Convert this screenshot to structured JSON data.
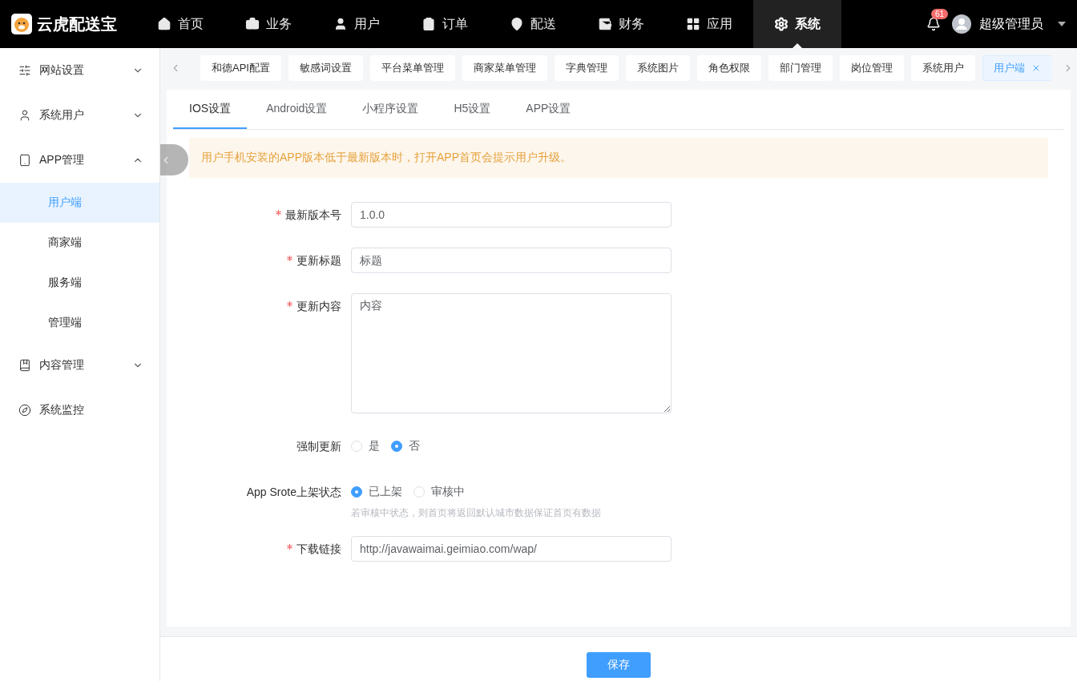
{
  "logo": {
    "text": "云虎配送宝"
  },
  "nav": [
    {
      "label": "首页",
      "selected": false
    },
    {
      "label": "业务",
      "selected": false
    },
    {
      "label": "用户",
      "selected": false
    },
    {
      "label": "订单",
      "selected": false
    },
    {
      "label": "配送",
      "selected": false
    },
    {
      "label": "财务",
      "selected": false
    },
    {
      "label": "应用",
      "selected": false
    },
    {
      "label": "系统",
      "selected": true
    }
  ],
  "notifications": {
    "count": "61"
  },
  "user": {
    "name": "超级管理员"
  },
  "sidebar": {
    "items": [
      {
        "label": "网站设置",
        "expanded": false
      },
      {
        "label": "系统用户",
        "expanded": false
      },
      {
        "label": "APP管理",
        "expanded": true,
        "children": [
          {
            "label": "用户端",
            "selected": true
          },
          {
            "label": "商家端",
            "selected": false
          },
          {
            "label": "服务端",
            "selected": false
          },
          {
            "label": "管理端",
            "selected": false
          }
        ]
      },
      {
        "label": "内容管理",
        "expanded": false
      },
      {
        "label": "系统监控"
      }
    ]
  },
  "page_tags": [
    {
      "label": "和德API配置",
      "selected": false
    },
    {
      "label": "敏感词设置",
      "selected": false
    },
    {
      "label": "平台菜单管理",
      "selected": false
    },
    {
      "label": "商家菜单管理",
      "selected": false
    },
    {
      "label": "字典管理",
      "selected": false
    },
    {
      "label": "系统图片",
      "selected": false
    },
    {
      "label": "角色权限",
      "selected": false
    },
    {
      "label": "部门管理",
      "selected": false
    },
    {
      "label": "岗位管理",
      "selected": false
    },
    {
      "label": "系统用户",
      "selected": false
    },
    {
      "label": "用户端",
      "selected": true
    }
  ],
  "tabs": [
    {
      "label": "IOS设置",
      "selected": true
    },
    {
      "label": "Android设置",
      "selected": false
    },
    {
      "label": "小程序设置",
      "selected": false
    },
    {
      "label": "H5设置",
      "selected": false
    },
    {
      "label": "APP设置",
      "selected": false
    }
  ],
  "alert": "用户手机安装的APP版本低于最新版本时，打开APP首页会提示用户升级。",
  "form": [
    {
      "kind": "input",
      "label": "最新版本号",
      "required": true,
      "value": "1.0.0"
    },
    {
      "kind": "input",
      "label": "更新标题",
      "required": true,
      "placeholder": "标题"
    },
    {
      "kind": "textarea",
      "label": "更新内容",
      "required": true,
      "placeholder": "内容"
    },
    {
      "kind": "radio",
      "label": "强制更新",
      "required": false,
      "options": [
        {
          "label": "是",
          "selected": false
        },
        {
          "label": "否",
          "selected": true
        }
      ]
    },
    {
      "kind": "radio",
      "label": "App Srote上架状态",
      "required": false,
      "options": [
        {
          "label": "已上架",
          "selected": true
        },
        {
          "label": "审核中",
          "selected": false
        }
      ],
      "hint": "若审核中状态，则首页将返回默认城市数据保证首页有数据"
    },
    {
      "kind": "input",
      "label": "下载链接",
      "required": true,
      "value": "http://javawaimai.geimiao.com/wap/"
    }
  ],
  "save_button": "保存"
}
